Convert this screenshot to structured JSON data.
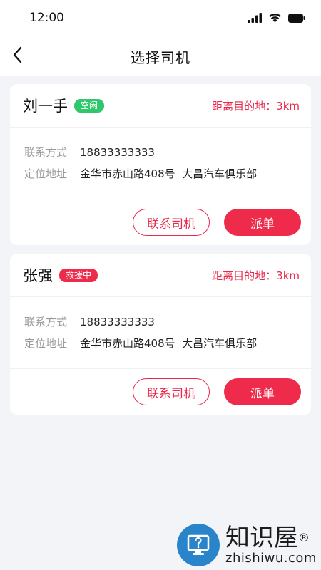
{
  "status_bar": {
    "time": "12:00",
    "icons": [
      "signal-icon",
      "wifi-icon",
      "battery-icon"
    ]
  },
  "header": {
    "title": "选择司机",
    "back_icon": "chevron-left-icon"
  },
  "colors": {
    "accent": "#ee2b4b",
    "idle_badge": "#2ec76b",
    "background": "#f3f4f8"
  },
  "drivers": [
    {
      "name": "刘一手",
      "status": "空闲",
      "distance": "距离目的地：3km",
      "phone_label": "联系方式",
      "phone": "18833333333",
      "address_label": "定位地址",
      "address": "金华市赤山路408号  大昌汽车俱乐部",
      "contact_label": "联系司机",
      "dispatch_label": "派单"
    },
    {
      "name": "张强",
      "status": "救援中",
      "distance": "距离目的地：3km",
      "phone_label": "联系方式",
      "phone": "18833333333",
      "address_label": "定位地址",
      "address": "金华市赤山路408号  大昌汽车俱乐部",
      "contact_label": "联系司机",
      "dispatch_label": "派单"
    }
  ],
  "watermark": {
    "name": "知识屋",
    "registered": "®",
    "domain": "zhishiwu.com",
    "logo_icon": "monitor-question-icon"
  }
}
